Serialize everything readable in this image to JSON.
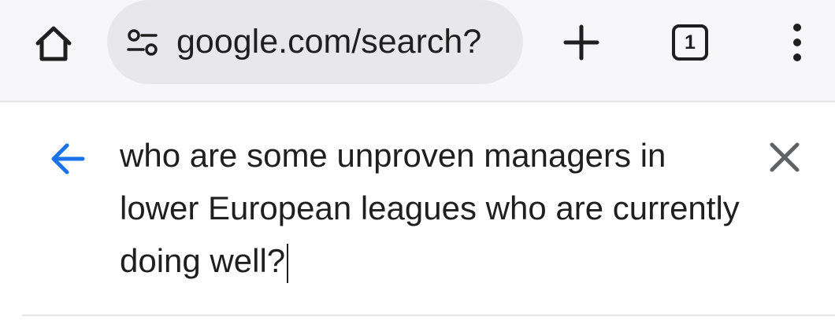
{
  "toolbar": {
    "home_icon": "home-icon",
    "url": "google.com/search?",
    "site_info_icon": "tune-icon",
    "new_tab_icon": "plus-icon",
    "tab_count": "1",
    "menu_icon": "more-vert-icon"
  },
  "search": {
    "back_icon": "arrow-back-icon",
    "query": "who are some unproven managers in lower European leagues who are currently doing well?",
    "clear_icon": "close-icon"
  },
  "colors": {
    "accent": "#1a73e8",
    "toolbar_bg": "#f7f7fa",
    "omnibox_bg": "#e8e8ec",
    "text": "#1f1f1f",
    "icon_gray": "#5f6368"
  }
}
